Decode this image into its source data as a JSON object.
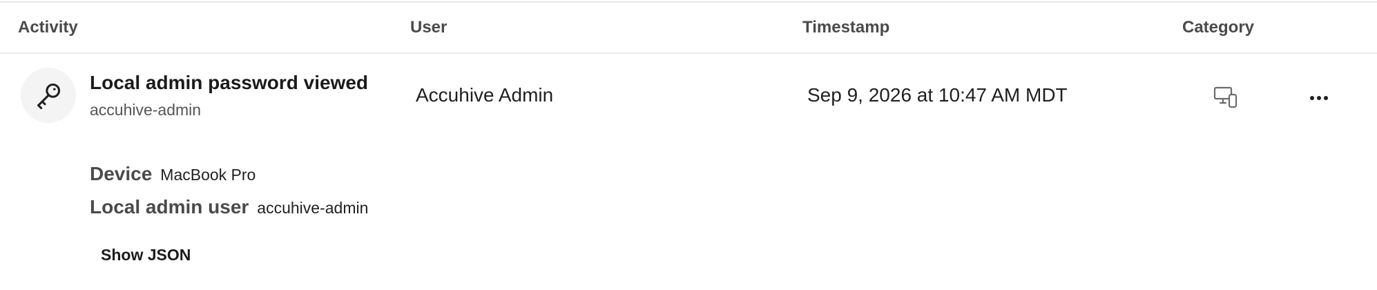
{
  "table": {
    "headers": {
      "activity": "Activity",
      "user": "User",
      "timestamp": "Timestamp",
      "category": "Category"
    },
    "rows": [
      {
        "activity_icon": "key-icon",
        "activity_title": "Local admin password viewed",
        "activity_subtitle": "accuhive-admin",
        "user": "Accuhive Admin",
        "timestamp": "Sep 9, 2026 at 10:47 AM MDT",
        "category_icon": "devices-icon",
        "more_icon": "more-horizontal-icon",
        "details": [
          {
            "label": "Device",
            "value": "MacBook Pro"
          },
          {
            "label": "Local admin user",
            "value": "accuhive-admin"
          }
        ],
        "show_json_label": "Show JSON"
      }
    ]
  },
  "colors": {
    "header_text": "#4a4a4a",
    "divider": "#e9e9e9",
    "avatar_bg": "#f4f4f4",
    "icon": "#1f1f1f",
    "category_icon": "#6b6b6b"
  }
}
